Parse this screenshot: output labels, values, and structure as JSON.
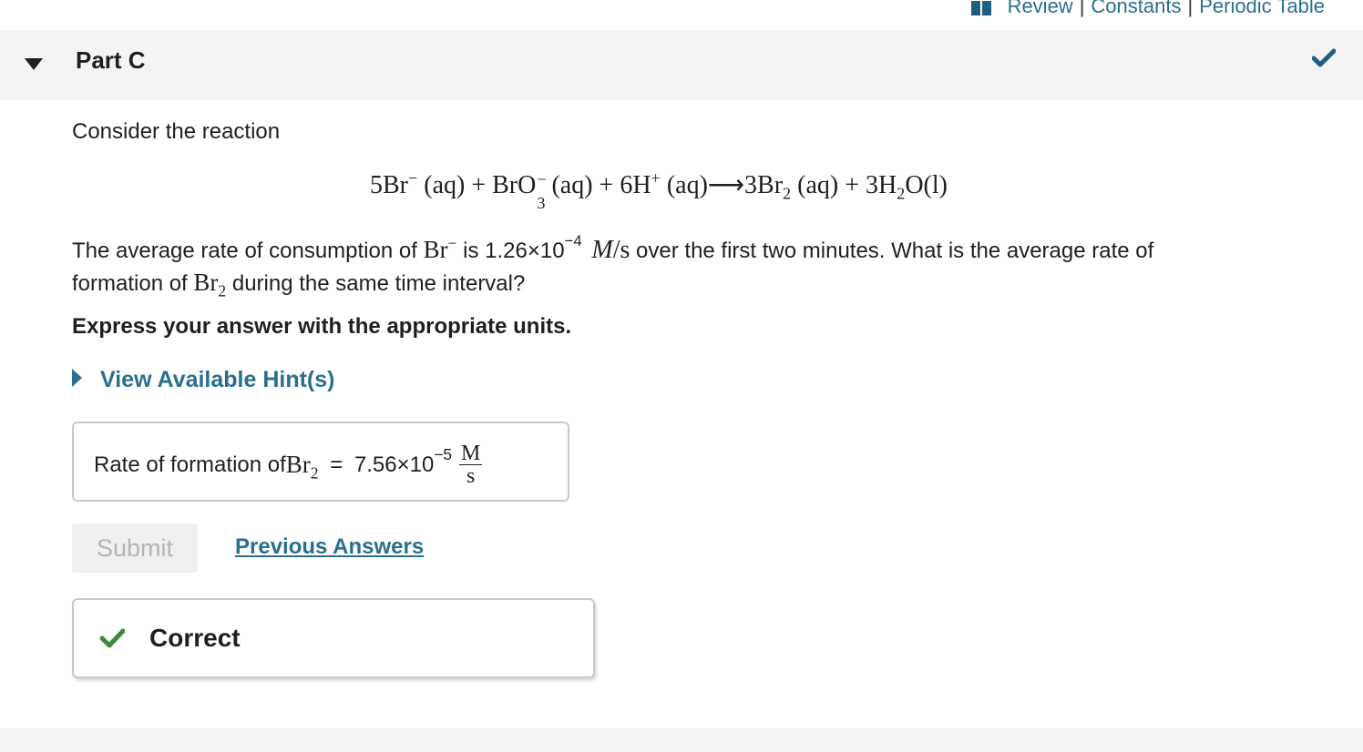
{
  "toolbar": {
    "review": "Review",
    "constants": "Constants",
    "periodic_table": "Periodic Table",
    "separator": "|"
  },
  "part": {
    "title": "Part C",
    "status_icon": "check-icon"
  },
  "question": {
    "intro": "Consider the reaction",
    "equation": {
      "t1": "5Br",
      "t1_sup": "−",
      "t2": "(aq) + BrO",
      "t2_sub": "3",
      "t2_sup": "−",
      "t3": "(aq) + 6H",
      "t3_sup": "+",
      "t4": "(aq)⟶3Br",
      "t4_sub": "2",
      "t5": "(aq) + 3H",
      "t5_sub": "2",
      "t6": "O(l)"
    },
    "line1_a": "The average rate of consumption of ",
    "line1_br": "Br",
    "line1_br_sup": "−",
    "line1_b": " is 1.26×10",
    "line1_exp": "−4",
    "line1_unit_m": "M",
    "line1_unit_s": "/s",
    "line1_c": " over the first two minutes. What is the average rate of",
    "line2_a": "formation of ",
    "line2_br": "Br",
    "line2_sub": "2",
    "line2_b": " during the same time interval?",
    "instruction": "Express your answer with the appropriate units."
  },
  "hints": {
    "label": "View Available Hint(s)"
  },
  "answer": {
    "label": "Rate of formation of ",
    "label_br": "Br",
    "label_sub": "2",
    "equals": " = ",
    "value_mantissa": "7.56×10",
    "value_exp": "−5",
    "unit_num": "M",
    "unit_den": "s"
  },
  "actions": {
    "submit_label": "Submit",
    "previous_answers_label": "Previous Answers"
  },
  "feedback": {
    "label": "Correct",
    "icon": "check-icon"
  },
  "colors": {
    "link": "#2a6f8f",
    "check_header": "#1f5f80",
    "check_correct": "#3a8a3a",
    "header_bg": "#f4f4f4"
  }
}
